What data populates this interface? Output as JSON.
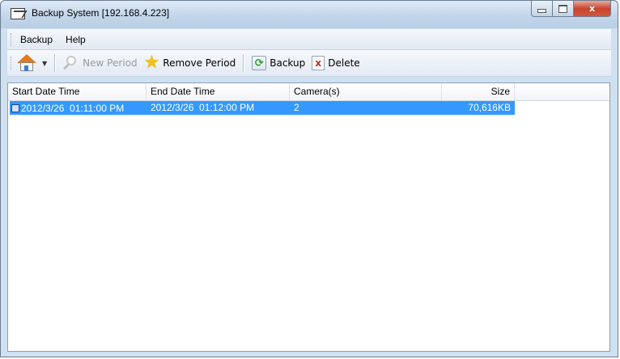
{
  "window": {
    "title": "Backup System [192.168.4.223]",
    "caption_buttons": {
      "minimize": "minimize",
      "maximize": "maximize",
      "close": "x"
    }
  },
  "menu": {
    "items": [
      "Backup",
      "Help"
    ]
  },
  "toolbar": {
    "home_icon": "home-icon",
    "new_period_label": "New Period",
    "remove_period_label": "Remove Period",
    "backup_label": "Backup",
    "delete_label": "Delete",
    "refresh_glyph": "⟳",
    "delete_glyph": "x",
    "star_glyph": "★",
    "dropdown_glyph": "▼"
  },
  "table": {
    "columns": [
      "Start Date Time",
      "End Date Time",
      "Camera(s)",
      "Size"
    ],
    "rows": [
      {
        "start": "2012/3/26  01:11:00 PM",
        "end": "2012/3/26  01:12:00 PM",
        "cameras": "2",
        "size": "70,616KB",
        "selected": true
      }
    ]
  },
  "colors": {
    "selection": "#3399ff",
    "titlebar": "#c3d6ea",
    "close_button": "#c7452f"
  }
}
